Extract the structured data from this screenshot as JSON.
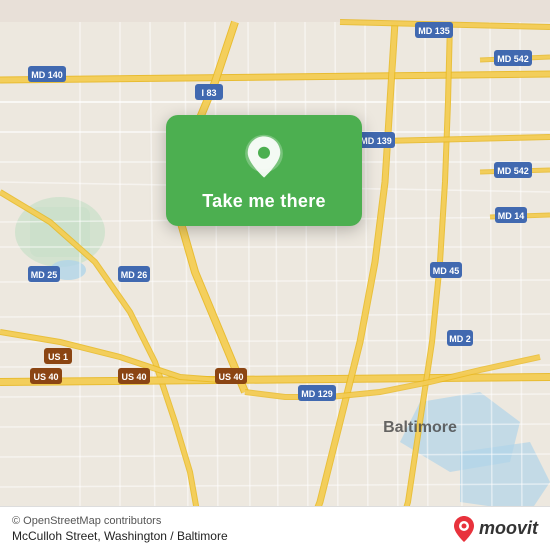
{
  "map": {
    "alt": "OpenStreetMap of Baltimore area",
    "copyright": "© OpenStreetMap contributors",
    "address": "McCulloh Street, Washington / Baltimore"
  },
  "popup": {
    "label": "Take me there"
  },
  "moovit": {
    "text": "moovit"
  },
  "road_labels": {
    "md140": "MD 140",
    "i83": "I 83",
    "md135": "MD 135",
    "md542a": "MD 542",
    "md25": "MD 25",
    "md26": "MD 26",
    "md139": "MD 139",
    "md542b": "MD 542",
    "md14": "MD 14",
    "md45": "MD 45",
    "us1": "US 1",
    "md129": "MD 129",
    "md2": "MD 2",
    "us40a": "US 40",
    "us40b": "US 40",
    "us40c": "US 40",
    "baltimore": "Baltimore"
  },
  "colors": {
    "map_bg": "#ede8df",
    "road_major": "#f5c842",
    "road_minor": "#ffffff",
    "road_outline": "#d4b830",
    "green_popup": "#4CAF50",
    "water": "#a8d4e8",
    "park": "#c8e6c0"
  }
}
